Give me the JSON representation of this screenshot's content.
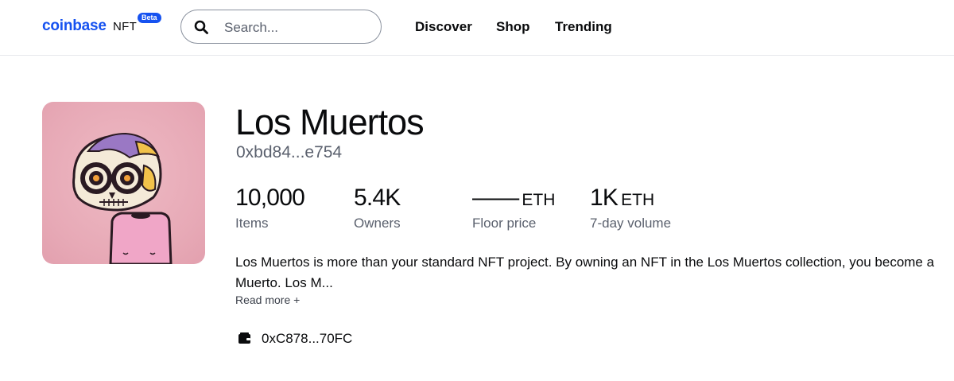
{
  "header": {
    "logo_brand": "coinbase",
    "logo_suffix": "NFT",
    "logo_badge": "Beta",
    "search_placeholder": "Search...",
    "nav": [
      "Discover",
      "Shop",
      "Trending"
    ]
  },
  "collection": {
    "name": "Los Muertos",
    "contract": "0xbd84...e754",
    "image_icon": "skull-avatar-image",
    "stats": [
      {
        "value": "10,000",
        "unit": "",
        "label": "Items"
      },
      {
        "value": "5.4K",
        "unit": "",
        "label": "Owners"
      },
      {
        "value": "——",
        "unit": "ETH",
        "label": "Floor price"
      },
      {
        "value": "1K",
        "unit": "ETH",
        "label": "7-day volume"
      }
    ],
    "description": "Los Muertos is more than your standard NFT project. By owning an NFT in the Los Muertos collection, you become a Muerto. Los M...",
    "read_more": "Read more +",
    "owner_icon": "wallet-icon",
    "owner_address": "0xC878...70FC"
  },
  "colors": {
    "brand_blue": "#1652f0",
    "muted_text": "#5b616e",
    "avatar_bg": "#e7a9b6"
  }
}
